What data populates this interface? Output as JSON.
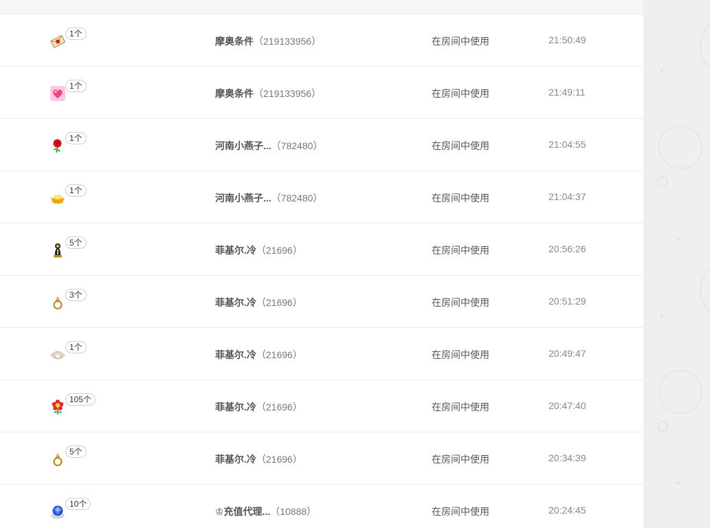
{
  "records": [
    {
      "icon": "sealed-letter-icon",
      "count": "1个",
      "sender_name": "摩奥条件",
      "sender_id": "（219133956）",
      "usage": "在房间中使用",
      "time": "21:50:49"
    },
    {
      "icon": "pink-heart-icon",
      "count": "1个",
      "sender_name": "摩奥条件",
      "sender_id": "（219133956）",
      "usage": "在房间中使用",
      "time": "21:49:11"
    },
    {
      "icon": "red-rose-icon",
      "count": "1个",
      "sender_name": "河南小燕子...",
      "sender_id": "（782480）",
      "usage": "在房间中使用",
      "time": "21:04:55"
    },
    {
      "icon": "gold-ingot-icon",
      "count": "1个",
      "sender_name": "河南小燕子...",
      "sender_id": "（782480）",
      "usage": "在房间中使用",
      "time": "21:04:37"
    },
    {
      "icon": "trophy-figure-icon",
      "count": "5个",
      "sender_name": "菲基尔.冷",
      "sender_id": "（21696）",
      "usage": "在房间中使用",
      "time": "20:56:26"
    },
    {
      "icon": "gold-ring-icon",
      "count": "3个",
      "sender_name": "菲基尔.冷",
      "sender_id": "（21696）",
      "usage": "在房间中使用",
      "time": "20:51:29"
    },
    {
      "icon": "pearl-shell-icon",
      "count": "1个",
      "sender_name": "菲基尔.冷",
      "sender_id": "（21696）",
      "usage": "在房间中使用",
      "time": "20:49:47"
    },
    {
      "icon": "red-flower-icon",
      "count": "105个",
      "sender_name": "菲基尔.冷",
      "sender_id": "（21696）",
      "usage": "在房间中使用",
      "time": "20:47:40"
    },
    {
      "icon": "gold-ring-icon",
      "count": "5个",
      "sender_name": "菲基尔.冷",
      "sender_id": "（21696）",
      "usage": "在房间中使用",
      "time": "20:34:39"
    },
    {
      "icon": "blue-gem-icon",
      "count": "10个",
      "sender_name": "♔充值代理...",
      "sender_id": "（10888）",
      "usage": "在房间中使用",
      "time": "20:24:45"
    }
  ]
}
